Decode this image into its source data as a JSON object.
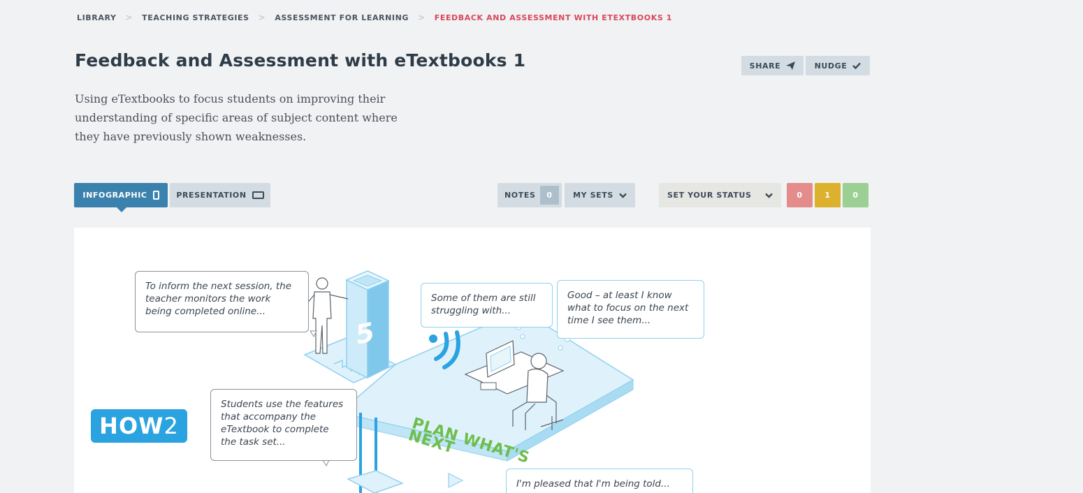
{
  "breadcrumb": {
    "items": [
      "LIBRARY",
      "TEACHING STRATEGIES",
      "ASSESSMENT FOR LEARNING"
    ],
    "current": "FEEDBACK AND ASSESSMENT WITH ETEXTBOOKS 1",
    "separator": ">"
  },
  "page": {
    "title": "Feedback and Assessment with eTextbooks 1",
    "description": "Using eTextbooks to focus students on improving their understanding of specific areas of subject content where they have previously shown weaknesses."
  },
  "actions": {
    "share_label": "SHARE",
    "nudge_label": "NUDGE"
  },
  "view_tabs": {
    "infographic": "INFOGRAPHIC",
    "presentation": "PRESENTATION",
    "active": "infographic"
  },
  "toolbar": {
    "notes_label": "NOTES",
    "notes_count": "0",
    "my_sets_label": "MY SETS",
    "status_label": "SET YOUR STATUS",
    "status_counts": {
      "red": "0",
      "yellow": "1",
      "green": "0"
    }
  },
  "infographic": {
    "bubble_teacher": "To inform the next session, the teacher monitors the work being completed online...",
    "bubble_struggling": "Some of them are still struggling with...",
    "bubble_good": "Good – at least I know what to focus on the next time I see them...",
    "bubble_students": "Students use the features that accompany the eTextbook to complete the task set...",
    "bubble_pleased": "I'm pleased that I'm being told...",
    "logo_text": "HOW",
    "logo_number": "2",
    "step_number": "5",
    "plan_line1": "PLAN WHAT'S",
    "plan_line2": "NEXT"
  },
  "colors": {
    "accent_blue": "#3a82ad",
    "breadcrumb_current": "#d9475a",
    "status_red": "#e48b8b",
    "status_yellow": "#dbb12e",
    "status_green": "#9bcf94",
    "logo_blue": "#2aa3e0",
    "plan_green": "#6ebe4c"
  },
  "icons": {
    "share": "paper-plane-icon",
    "nudge": "checkmark-icon",
    "infographic": "phone-icon",
    "presentation": "screen-icon",
    "dropdown": "chevron-down-icon"
  }
}
